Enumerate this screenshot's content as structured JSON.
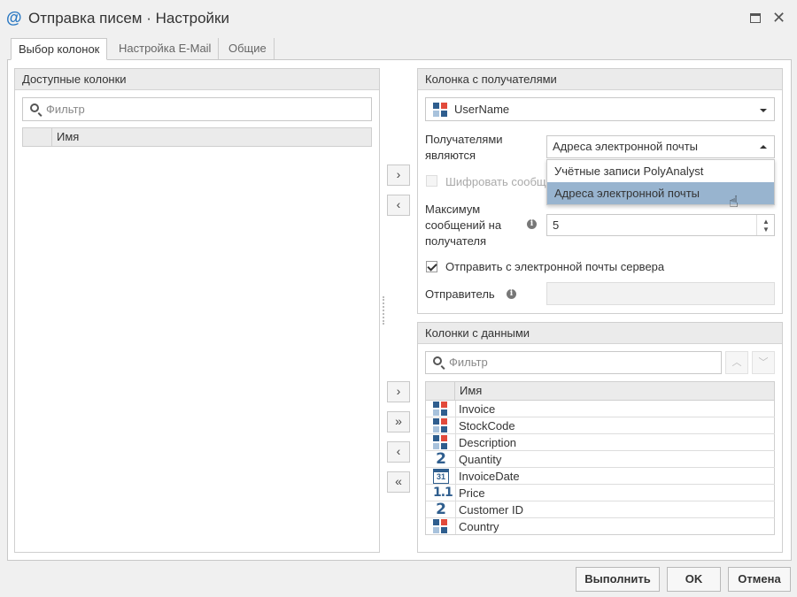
{
  "window": {
    "title": "Отправка писем · Настройки",
    "icon": "at-sign-icon"
  },
  "tabs": [
    {
      "label": "Выбор колонок",
      "active": true
    },
    {
      "label": "Настройка E-Mail",
      "active": false
    },
    {
      "label": "Общие",
      "active": false
    }
  ],
  "available_columns": {
    "header": "Доступные колонки",
    "filter_placeholder": "Фильтр",
    "grid_header": "Имя"
  },
  "recipients": {
    "header": "Колонка с получателями",
    "column_value": "UserName",
    "recipients_are_label": "Получателями являются",
    "recipients_are_value": "Адреса электронной почты",
    "dropdown_options": [
      "Учётные записи PolyAnalyst",
      "Адреса электронной почты"
    ],
    "selected_option_index": 1,
    "encrypt_label": "Шифровать сообщения",
    "encrypt_checked": false,
    "max_messages_label": "Максимум сообщений на получателя",
    "max_messages_value": "5",
    "send_from_server_label": "Отправить с электронной почты сервера",
    "send_from_server_checked": true,
    "sender_label": "Отправитель",
    "sender_value": ""
  },
  "data_columns": {
    "header": "Колонки с данными",
    "filter_placeholder": "Фильтр",
    "grid_header": "Имя",
    "rows": [
      {
        "name": "Invoice",
        "type_icon": "text-column-icon"
      },
      {
        "name": "StockCode",
        "type_icon": "text-column-icon"
      },
      {
        "name": "Description",
        "type_icon": "text-column-icon"
      },
      {
        "name": "Quantity",
        "type_icon": "integer-column-icon",
        "glyph": "2"
      },
      {
        "name": "InvoiceDate",
        "type_icon": "date-column-icon",
        "glyph": "31"
      },
      {
        "name": "Price",
        "type_icon": "numeric-column-icon",
        "glyph": "1.1"
      },
      {
        "name": "Customer ID",
        "type_icon": "integer-column-icon",
        "glyph": "2"
      },
      {
        "name": "Country",
        "type_icon": "text-column-icon"
      }
    ]
  },
  "move_buttons": {
    "add": "›",
    "remove": "‹",
    "add_all": "»",
    "remove_all": "«"
  },
  "footer": {
    "run_label": "Выполнить",
    "ok_label": "OK",
    "cancel_label": "Отмена"
  }
}
